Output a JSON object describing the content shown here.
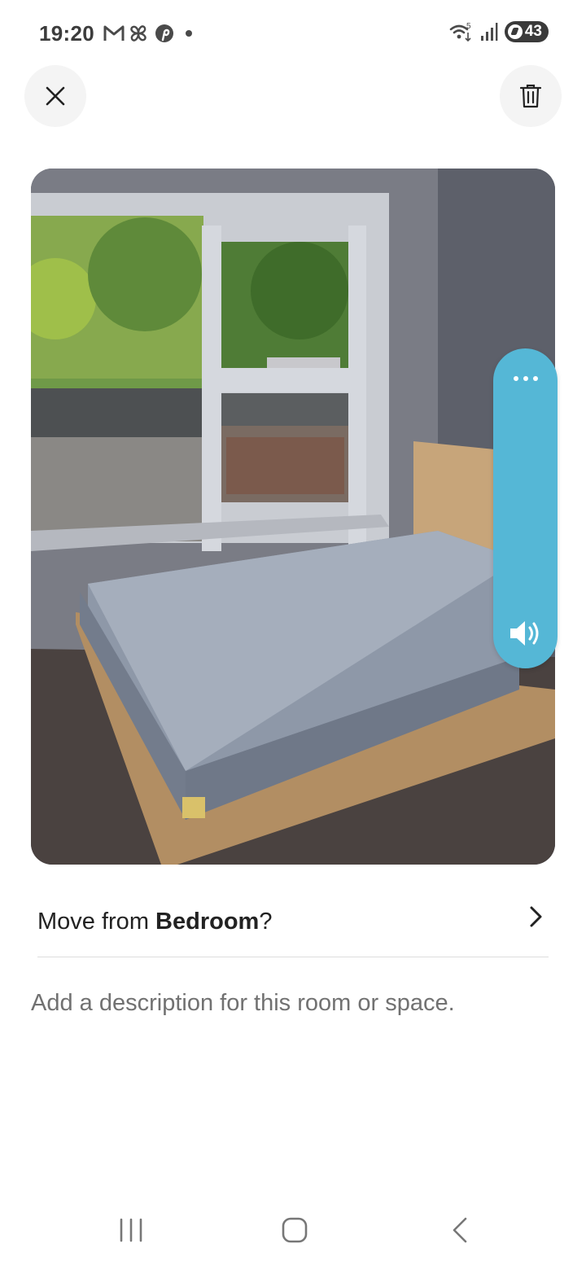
{
  "status_bar": {
    "time": "19:20",
    "notification_icons": [
      "gmail-icon",
      "pinwheel-icon",
      "pinterest-icon",
      "dot-icon"
    ],
    "wifi_label": "5",
    "battery_level": "43"
  },
  "top_bar": {
    "close_icon": "close-icon",
    "delete_icon": "trash-icon"
  },
  "side_panel": {
    "more_icon": "more-dots-icon",
    "volume_icon": "speaker-icon",
    "color": "#55b7d6"
  },
  "move_row": {
    "prefix": "Move from ",
    "room": "Bedroom",
    "suffix": "?"
  },
  "description": {
    "placeholder": "Add a description for this room or space."
  },
  "nav_bar": {
    "icons": [
      "recents-icon",
      "home-icon",
      "back-icon"
    ]
  }
}
